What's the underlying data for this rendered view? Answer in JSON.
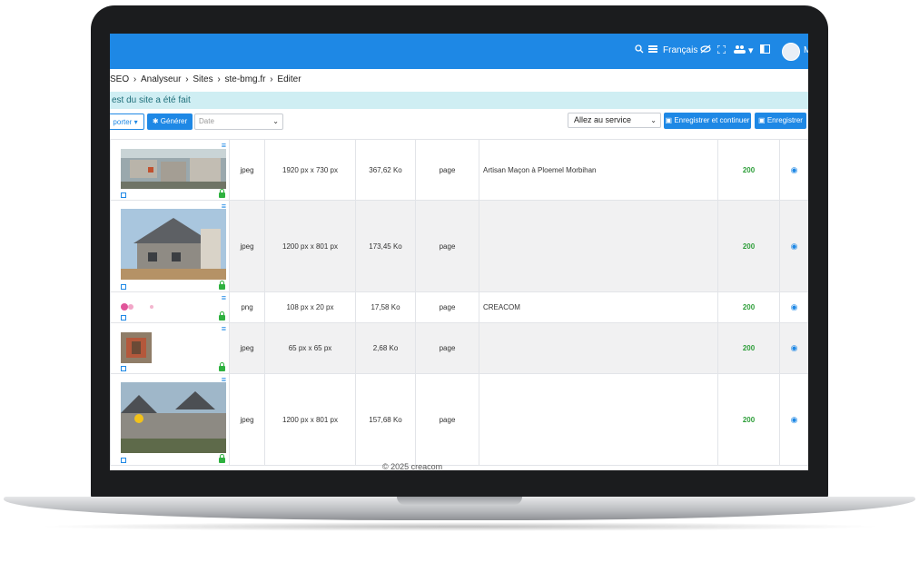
{
  "topbar": {
    "language": "Français",
    "user_initial": "M"
  },
  "breadcrumb": [
    "SEO",
    "Analyseur",
    "Sites",
    "ste-bmg.fr",
    "Editer"
  ],
  "alert": {
    "text": "est du site a été fait"
  },
  "toolbar": {
    "export_label": "porter",
    "generate_label": "Générer",
    "date_placeholder": "Date",
    "service_select": "Allez au service",
    "save_continue_label": "Enregistrer et continuer",
    "save_label": "Enregistrer"
  },
  "table": {
    "rows": [
      {
        "format": "jpeg",
        "dimensions": "1920 px x 730 px",
        "size": "367,62 Ko",
        "type": "page",
        "title": "Artisan Maçon à Ploemel Morbihan",
        "status": "200"
      },
      {
        "format": "jpeg",
        "dimensions": "1200 px x 801 px",
        "size": "173,45 Ko",
        "type": "page",
        "title": "",
        "status": "200"
      },
      {
        "format": "png",
        "dimensions": "108 px x 20 px",
        "size": "17,58 Ko",
        "type": "page",
        "title": "CREACOM",
        "status": "200"
      },
      {
        "format": "jpeg",
        "dimensions": "65 px x 65 px",
        "size": "2,68 Ko",
        "type": "page",
        "title": "",
        "status": "200"
      },
      {
        "format": "jpeg",
        "dimensions": "1200 px x 801 px",
        "size": "157,68 Ko",
        "type": "page",
        "title": "",
        "status": "200"
      }
    ]
  },
  "footer": {
    "text": "© 2025 creacom"
  },
  "icons": {
    "row_menu": "hamburger-icon",
    "row_view": "eye-icon",
    "row_lock": "lock-icon"
  },
  "colors": {
    "primary": "#1e88e5",
    "alert_bg": "#cfeef3",
    "status_ok": "#2e9e3a"
  }
}
